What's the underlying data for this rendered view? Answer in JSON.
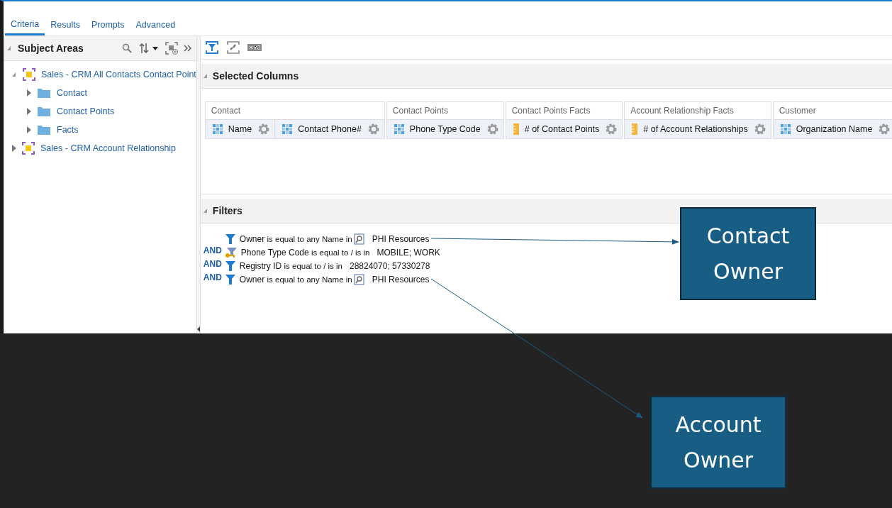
{
  "tabs": [
    {
      "label": "Criteria",
      "selected": true
    },
    {
      "label": "Results",
      "selected": false
    },
    {
      "label": "Prompts",
      "selected": false
    },
    {
      "label": "Advanced",
      "selected": false
    }
  ],
  "subject_areas": {
    "title": "Subject Areas",
    "expanded": true,
    "tree": [
      {
        "label": "Sales - CRM All Contacts Contact Point",
        "kind": "area",
        "expanded": true,
        "children": [
          {
            "label": "Contact",
            "kind": "folder",
            "expanded": false
          },
          {
            "label": "Contact Points",
            "kind": "folder",
            "expanded": false
          },
          {
            "label": "Facts",
            "kind": "folder",
            "expanded": false
          }
        ]
      },
      {
        "label": "Sales - CRM Account Relationship",
        "kind": "area",
        "expanded": false
      }
    ]
  },
  "selected_columns": {
    "title": "Selected Columns",
    "expanded": true,
    "groups": [
      {
        "heading": "Contact",
        "columns": [
          {
            "label": "Name",
            "kind": "attribute"
          },
          {
            "label": "Contact Phone#",
            "kind": "attribute"
          }
        ]
      },
      {
        "heading": "Contact Points",
        "columns": [
          {
            "label": "Phone Type Code",
            "kind": "attribute"
          }
        ]
      },
      {
        "heading": "Contact Points Facts",
        "columns": [
          {
            "label": "# of Contact Points",
            "kind": "measure"
          }
        ]
      },
      {
        "heading": "Account Relationship Facts",
        "columns": [
          {
            "label": "# of Account Relationships",
            "kind": "measure"
          }
        ]
      },
      {
        "heading": "Customer",
        "columns": [
          {
            "label": "Organization Name",
            "kind": "attribute"
          }
        ]
      }
    ]
  },
  "filters": {
    "title": "Filters",
    "expanded": true,
    "rows": [
      {
        "connector": "",
        "kind": "filter",
        "field": "Owner",
        "operator": "is equal to any  Name in",
        "lookup": true,
        "value": "PHI Resources"
      },
      {
        "connector": "AND",
        "kind": "prompted",
        "field": "Phone Type Code",
        "operator": "is equal to / is in",
        "lookup": false,
        "value": "MOBILE; WORK"
      },
      {
        "connector": "AND",
        "kind": "filter",
        "field": "Registry ID",
        "operator": "is equal to / is in",
        "lookup": false,
        "value": "28824070; 57330278"
      },
      {
        "connector": "AND",
        "kind": "filter",
        "field": "Owner",
        "operator": "is equal to any  Name in",
        "lookup": true,
        "value": "PHI Resources"
      }
    ]
  },
  "callouts": [
    {
      "label": "Contact Owner"
    },
    {
      "label": "Account Owner"
    }
  ]
}
